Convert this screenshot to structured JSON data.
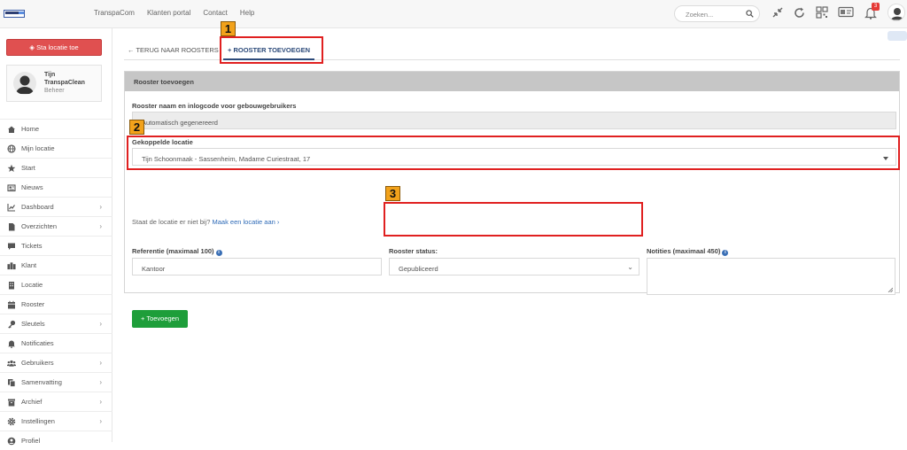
{
  "topbar": {
    "nav": [
      "TranspaCom",
      "Klanten portal",
      "Contact",
      "Help"
    ],
    "search_placeholder": "Zoeken...",
    "notification_count": "3",
    "icons": [
      "search-icon",
      "collapse-icon",
      "refresh-icon",
      "qr-code-icon",
      "id-card-icon",
      "bell-icon",
      "user-avatar-icon"
    ]
  },
  "sidebar": {
    "location_button": "Sta locatie toe",
    "user": {
      "first": "Tijn",
      "company": "TranspaClean",
      "role": "Beheer"
    },
    "items": [
      {
        "label": "Home",
        "icon": "home-icon",
        "chevron": false
      },
      {
        "label": "Mijn locatie",
        "icon": "globe-icon",
        "chevron": false
      },
      {
        "label": "Start",
        "icon": "star-icon",
        "chevron": false
      },
      {
        "label": "Nieuws",
        "icon": "news-icon",
        "chevron": false
      },
      {
        "label": "Dashboard",
        "icon": "chart-icon",
        "chevron": true
      },
      {
        "label": "Overzichten",
        "icon": "file-icon",
        "chevron": true
      },
      {
        "label": "Tickets",
        "icon": "comment-icon",
        "chevron": false
      },
      {
        "label": "Klant",
        "icon": "building-icon",
        "chevron": false
      },
      {
        "label": "Locatie",
        "icon": "building-small-icon",
        "chevron": false
      },
      {
        "label": "Rooster",
        "icon": "calendar-icon",
        "chevron": false
      },
      {
        "label": "Sleutels",
        "icon": "key-icon",
        "chevron": true
      },
      {
        "label": "Notificaties",
        "icon": "bell-icon",
        "chevron": false
      },
      {
        "label": "Gebruikers",
        "icon": "users-icon",
        "chevron": true
      },
      {
        "label": "Samenvatting",
        "icon": "copy-icon",
        "chevron": true
      },
      {
        "label": "Archief",
        "icon": "archive-icon",
        "chevron": true
      },
      {
        "label": "Instellingen",
        "icon": "gear-icon",
        "chevron": true
      },
      {
        "label": "Profiel",
        "icon": "user-icon",
        "chevron": false
      }
    ]
  },
  "tabs": {
    "back": "← TERUG NAAR ROOSTERS",
    "add": "+ ROOSTER TOEVOEGEN"
  },
  "form": {
    "title": "Rooster toevoegen",
    "name_label": "Rooster naam en inlogcode voor gebouwgebruikers",
    "name_value": "Automatisch gegenereerd",
    "location_label": "Gekoppelde locatie",
    "location_value": "Tijn Schoonmaak - Sassenheim, Madame Curiestraat, 17",
    "help_text": "Staat de locatie er niet bij?",
    "help_link": "Maak een locatie aan ›",
    "reference_label": "Referentie (maximaal 100)",
    "reference_value": "Kantoor",
    "status_label": "Rooster status:",
    "status_value": "Gepubliceerd",
    "notes_label": "Notities (maximaal 450)",
    "notes_value": "",
    "submit": "+ Toevoegen"
  },
  "annotations": [
    "1",
    "2",
    "3"
  ],
  "colors": {
    "accent": "#2c4a7a",
    "highlight": "#e02020",
    "badge": "#f2a21b",
    "submit": "#1e9e3a",
    "location_button": "#e05050"
  }
}
